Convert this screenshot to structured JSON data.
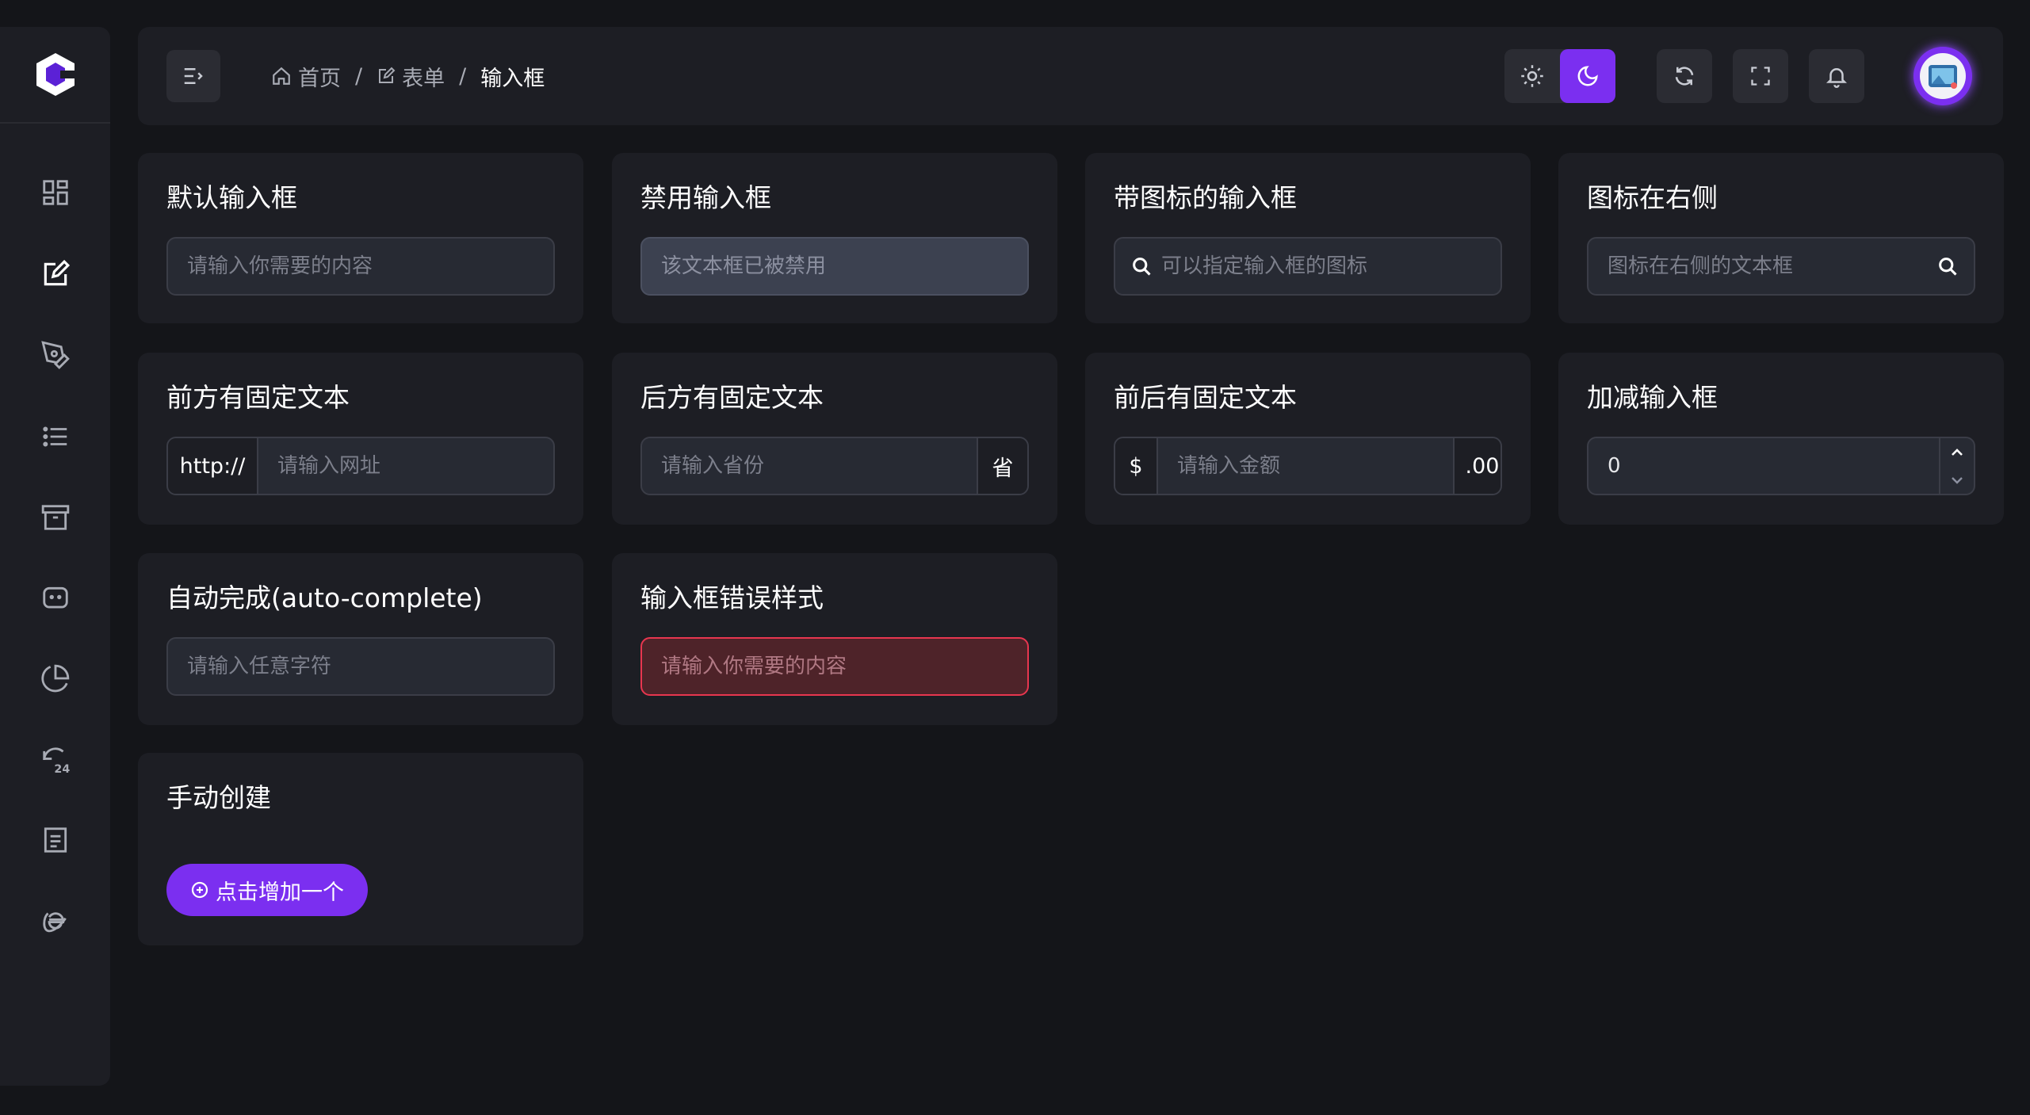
{
  "breadcrumb": {
    "home": "首页",
    "form": "表单",
    "current": "输入框",
    "sep": "/"
  },
  "colors": {
    "accent": "#7b2ff0",
    "error": "#e8364f",
    "card": "#1d1e24",
    "bg": "#141519"
  },
  "cards": {
    "default": {
      "title": "默认输入框",
      "placeholder": "请输入你需要的内容"
    },
    "disabled": {
      "title": "禁用输入框",
      "placeholder": "该文本框已被禁用"
    },
    "icon_left": {
      "title": "带图标的输入框",
      "placeholder": "可以指定输入框的图标",
      "icon": "search-icon"
    },
    "icon_right": {
      "title": "图标在右侧",
      "placeholder": "图标在右侧的文本框",
      "icon": "search-icon"
    },
    "prepend": {
      "title": "前方有固定文本",
      "addon": "http://",
      "placeholder": "请输入网址"
    },
    "append": {
      "title": "后方有固定文本",
      "addon": "省",
      "placeholder": "请输入省份"
    },
    "both": {
      "title": "前后有固定文本",
      "prefix": "$",
      "suffix": ".00",
      "placeholder": "请输入金额"
    },
    "number": {
      "title": "加减输入框",
      "value": "0"
    },
    "autocomplete": {
      "title": "自动完成(auto-complete)",
      "placeholder": "请输入任意字符"
    },
    "error": {
      "title": "输入框错误样式",
      "placeholder": "请输入你需要的内容"
    },
    "manual": {
      "title": "手动创建",
      "button": "点击增加一个"
    }
  },
  "sidebar_icons": [
    "dashboard-icon",
    "form-edit-icon",
    "pen-tool-icon",
    "list-icon",
    "archive-icon",
    "chat-bubble-icon",
    "pie-chart-icon",
    "history-24-icon",
    "document-icon",
    "ie-browser-icon"
  ]
}
